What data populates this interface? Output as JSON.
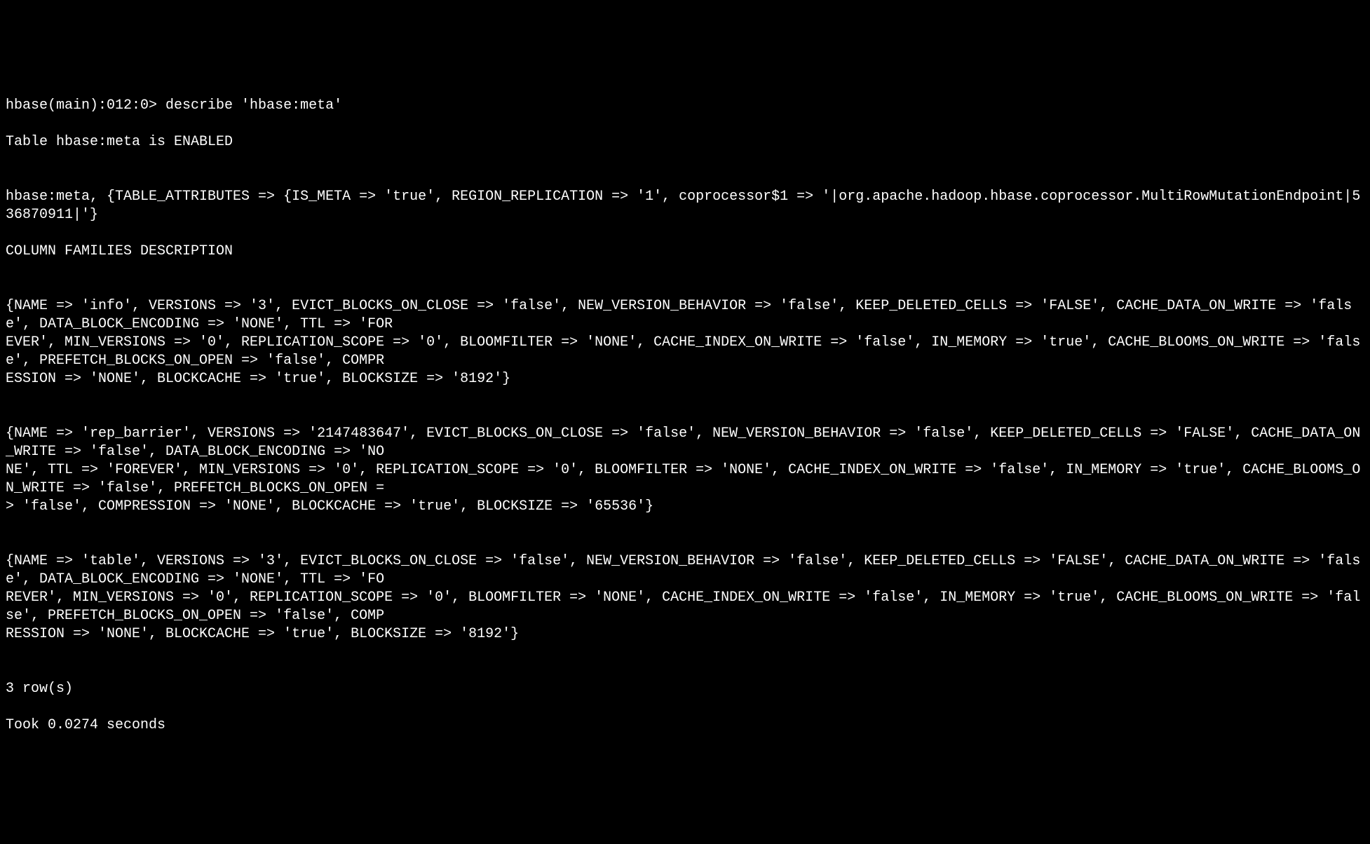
{
  "terminal": {
    "prompt_line": "hbase(main):012:0> describe 'hbase:meta'",
    "table_status": "Table hbase:meta is ENABLED",
    "blank1": "",
    "table_attributes": "hbase:meta, {TABLE_ATTRIBUTES => {IS_META => 'true', REGION_REPLICATION => '1', coprocessor$1 => '|org.apache.hadoop.hbase.coprocessor.MultiRowMutationEndpoint|536870911|'}",
    "column_families_header": "COLUMN FAMILIES DESCRIPTION",
    "blank2": "",
    "cf_info": "{NAME => 'info', VERSIONS => '3', EVICT_BLOCKS_ON_CLOSE => 'false', NEW_VERSION_BEHAVIOR => 'false', KEEP_DELETED_CELLS => 'FALSE', CACHE_DATA_ON_WRITE => 'false', DATA_BLOCK_ENCODING => 'NONE', TTL => 'FOR\nEVER', MIN_VERSIONS => '0', REPLICATION_SCOPE => '0', BLOOMFILTER => 'NONE', CACHE_INDEX_ON_WRITE => 'false', IN_MEMORY => 'true', CACHE_BLOOMS_ON_WRITE => 'false', PREFETCH_BLOCKS_ON_OPEN => 'false', COMPR\nESSION => 'NONE', BLOCKCACHE => 'true', BLOCKSIZE => '8192'}",
    "blank3": "",
    "cf_rep_barrier": "{NAME => 'rep_barrier', VERSIONS => '2147483647', EVICT_BLOCKS_ON_CLOSE => 'false', NEW_VERSION_BEHAVIOR => 'false', KEEP_DELETED_CELLS => 'FALSE', CACHE_DATA_ON_WRITE => 'false', DATA_BLOCK_ENCODING => 'NO\nNE', TTL => 'FOREVER', MIN_VERSIONS => '0', REPLICATION_SCOPE => '0', BLOOMFILTER => 'NONE', CACHE_INDEX_ON_WRITE => 'false', IN_MEMORY => 'true', CACHE_BLOOMS_ON_WRITE => 'false', PREFETCH_BLOCKS_ON_OPEN =\n> 'false', COMPRESSION => 'NONE', BLOCKCACHE => 'true', BLOCKSIZE => '65536'}",
    "blank4": "",
    "cf_table": "{NAME => 'table', VERSIONS => '3', EVICT_BLOCKS_ON_CLOSE => 'false', NEW_VERSION_BEHAVIOR => 'false', KEEP_DELETED_CELLS => 'FALSE', CACHE_DATA_ON_WRITE => 'false', DATA_BLOCK_ENCODING => 'NONE', TTL => 'FO\nREVER', MIN_VERSIONS => '0', REPLICATION_SCOPE => '0', BLOOMFILTER => 'NONE', CACHE_INDEX_ON_WRITE => 'false', IN_MEMORY => 'true', CACHE_BLOOMS_ON_WRITE => 'false', PREFETCH_BLOCKS_ON_OPEN => 'false', COMP\nRESSION => 'NONE', BLOCKCACHE => 'true', BLOCKSIZE => '8192'}",
    "blank5": "",
    "row_count": "3 row(s)",
    "timing": "Took 0.0274 seconds"
  }
}
